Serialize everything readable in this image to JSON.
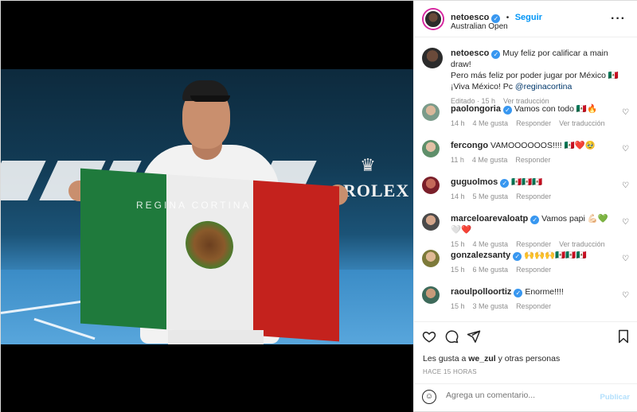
{
  "post": {
    "username": "netoesco",
    "follow_label": "Seguir",
    "separator": "•",
    "location": "Australian Open",
    "caption_lines": [
      "Muy feliz por calificar a main draw!",
      "Pero más feliz por poder jugar por México 🇲🇽",
      "¡Viva México! Pc "
    ],
    "caption_mention": "@reginacortina",
    "caption_meta": {
      "edited": "Editado · 15 h",
      "translate": "Ver traducción"
    },
    "photo_flag_text": "REGINA CORTINA",
    "photo_sponsor_text": "ROLEX"
  },
  "comments": [
    {
      "user": "paolongoria",
      "verified": true,
      "text": "Vamos con todo 🇲🇽🔥",
      "time": "14 h",
      "likes": "4 Me gusta",
      "reply": "Responder",
      "translate": "Ver traducción"
    },
    {
      "user": "fercongo",
      "verified": false,
      "text": "VAMOOOOOOS!!!! 🇲🇽❤️🥹",
      "time": "11 h",
      "likes": "4 Me gusta",
      "reply": "Responder",
      "translate": ""
    },
    {
      "user": "guguolmos",
      "verified": true,
      "text": "🇲🇽🇲🇽🇲🇽",
      "time": "14 h",
      "likes": "5 Me gusta",
      "reply": "Responder",
      "translate": ""
    },
    {
      "user": "marceloarevaloatp",
      "verified": true,
      "text": "Vamos papi 💪🏻💚🤍❤️",
      "time": "15 h",
      "likes": "4 Me gusta",
      "reply": "Responder",
      "translate": "Ver traducción"
    },
    {
      "user": "gonzalezsanty",
      "verified": true,
      "text": "🙌🙌🙌🇲🇽🇲🇽🇲🇽",
      "time": "15 h",
      "likes": "6 Me gusta",
      "reply": "Responder",
      "translate": ""
    },
    {
      "user": "raoulpolloortiz",
      "verified": true,
      "text": "Enorme!!!!",
      "time": "15 h",
      "likes": "3 Me gusta",
      "reply": "Responder",
      "translate": ""
    }
  ],
  "actions": {
    "likes_text": "Les gusta a ",
    "likes_user": "we_zul",
    "likes_rest": " y otras personas",
    "time_ago": "HACE 15 HORAS",
    "comment_placeholder": "Agrega un comentario...",
    "publish_label": "Publicar"
  },
  "icons": {
    "heart": "heart-icon",
    "comment": "comment-icon",
    "share": "share-icon",
    "save": "bookmark-icon",
    "emoji": "emoji-icon",
    "more": "more-icon"
  },
  "colors": {
    "accent": "#0095f6",
    "verified": "#3897f0",
    "flag_green": "#1f7a3c",
    "flag_red": "#c4221d"
  }
}
